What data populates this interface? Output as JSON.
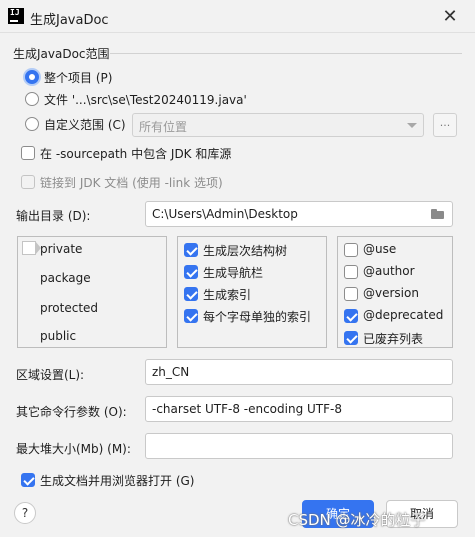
{
  "window": {
    "app_icon_text": "IJ",
    "title": "生成JavaDoc",
    "close_glyph": "✕"
  },
  "scope": {
    "section_title": "生成JavaDoc范围",
    "whole_project": "整个项目 (P)",
    "file": "文件 '...\\src\\se\\Test20240119.java'",
    "custom_scope": "自定义范围 (C)",
    "custom_scope_value": "所有位置",
    "browse_label": "...",
    "selected": "whole_project"
  },
  "options": {
    "include_jdk": {
      "label": "在 -sourcepath 中包含 JDK 和库源",
      "checked": false
    },
    "link_jdk": {
      "label": "链接到 JDK 文档 (使用 -link 选项)",
      "checked": false,
      "disabled": true
    }
  },
  "output": {
    "label": "输出目录 (D):",
    "value": "C:\\Users\\Admin\\Desktop",
    "icon": "folder-icon"
  },
  "visibility_levels": [
    "private",
    "package",
    "protected",
    "public"
  ],
  "generation_options": [
    {
      "label": "生成层次结构树",
      "checked": true
    },
    {
      "label": "生成导航栏",
      "checked": true
    },
    {
      "label": "生成索引",
      "checked": true
    },
    {
      "label": "每个字母单独的索引",
      "checked": true
    }
  ],
  "tag_options": [
    {
      "label": "@use",
      "checked": false
    },
    {
      "label": "@author",
      "checked": false
    },
    {
      "label": "@version",
      "checked": false
    },
    {
      "label": "@deprecated",
      "checked": true
    },
    {
      "label": "已废弃列表",
      "checked": true
    }
  ],
  "locale": {
    "label": "区域设置(L):",
    "value": "zh_CN"
  },
  "other_args": {
    "label": "其它命令行参数 (O):",
    "value": "-charset UTF-8 -encoding UTF-8"
  },
  "max_heap": {
    "label": "最大堆大小(Mb) (M):",
    "value": ""
  },
  "open_browser": {
    "label": "生成文档并用浏览器打开 (G)",
    "checked": true
  },
  "footer": {
    "help_glyph": "?",
    "ok_label": "确定",
    "cancel_label": "取消",
    "watermark": "CSDN @冰冷的粒子"
  },
  "colors": {
    "accent": "#3574f0",
    "background": "#f2f2f2"
  }
}
